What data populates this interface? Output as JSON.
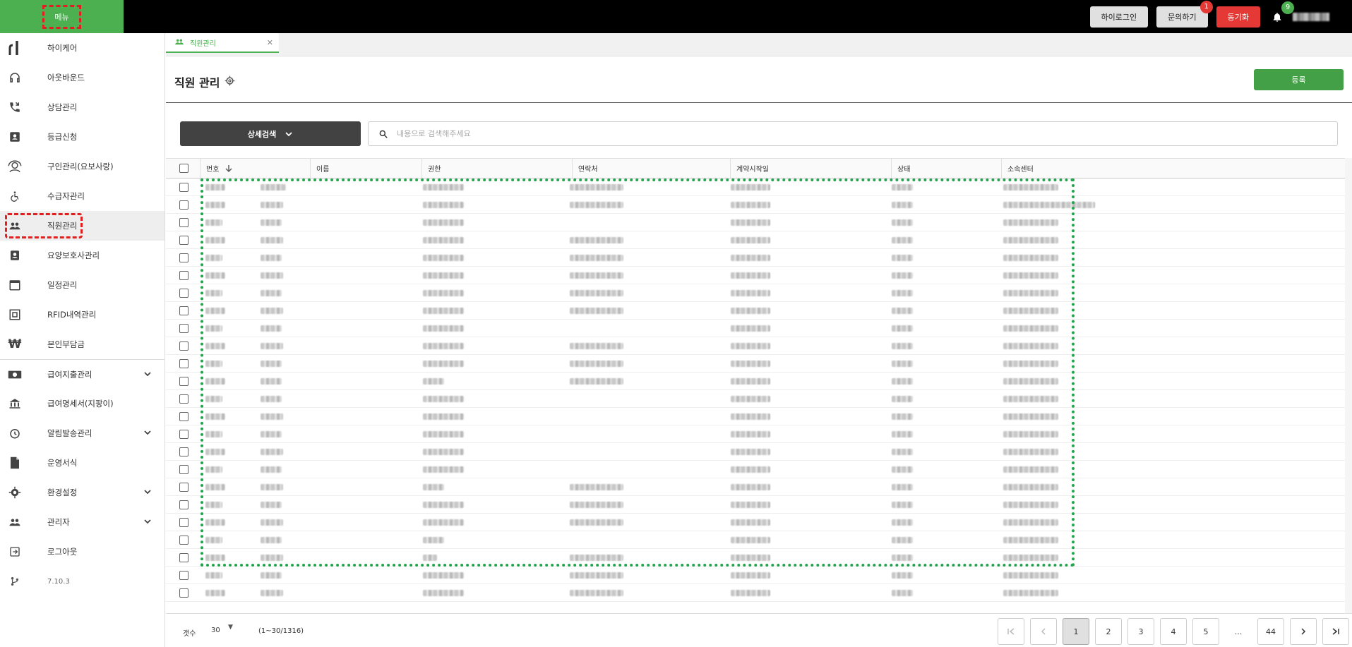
{
  "topbar": {
    "menu_label": "메뉴",
    "buttons": {
      "hi_login": "하이로그인",
      "inquiry": "문의하기",
      "inquiry_badge": "1",
      "sync": "동기화",
      "bell_badge": "9"
    }
  },
  "sidebar": {
    "items": [
      {
        "label": "하이케어",
        "icon": "hicare-logo-icon"
      },
      {
        "label": "아웃바운드",
        "icon": "headset-icon"
      },
      {
        "label": "상담관리",
        "icon": "phone-call-icon"
      },
      {
        "label": "등급신청",
        "icon": "id-card-icon"
      },
      {
        "label": "구인관리(요보사랑)",
        "icon": "support-agent-icon"
      },
      {
        "label": "수급자관리",
        "icon": "wheelchair-icon"
      },
      {
        "label": "직원관리",
        "icon": "people-icon"
      },
      {
        "label": "요양보호사관리",
        "icon": "badge-icon"
      },
      {
        "label": "일정관리",
        "icon": "calendar-icon"
      },
      {
        "label": "RFID내역관리",
        "icon": "rfid-icon"
      },
      {
        "label": "본인부담금",
        "icon": "won-icon"
      },
      {
        "label": "급여지출관리",
        "icon": "money-icon"
      },
      {
        "label": "급여명세서(지팡이)",
        "icon": "bank-icon"
      },
      {
        "label": "알림발송관리",
        "icon": "alarm-icon"
      },
      {
        "label": "운영서식",
        "icon": "document-icon"
      },
      {
        "label": "환경설정",
        "icon": "gear-icon"
      },
      {
        "label": "관리자",
        "icon": "admin-icon"
      },
      {
        "label": "로그아웃",
        "icon": "logout-icon"
      },
      {
        "label": "7.10.3",
        "icon": "branch-icon"
      }
    ]
  },
  "tab": {
    "label": "직원관리"
  },
  "header": {
    "title": "직원 관리",
    "register_label": "등록"
  },
  "search": {
    "advanced_label": "상세검색",
    "placeholder": "내용으로 검색해주세요"
  },
  "table": {
    "columns": [
      "번호",
      "이름",
      "권한",
      "연락처",
      "계약시작일",
      "상태",
      "소속센터"
    ],
    "rows": [
      [
        28,
        36,
        58,
        76,
        56,
        30,
        78
      ],
      [
        28,
        32,
        58,
        76,
        56,
        30,
        130
      ],
      [
        24,
        30,
        58,
        0,
        56,
        30,
        78
      ],
      [
        28,
        32,
        58,
        76,
        56,
        30,
        78
      ],
      [
        24,
        30,
        58,
        76,
        56,
        30,
        78
      ],
      [
        28,
        32,
        58,
        76,
        56,
        30,
        78
      ],
      [
        24,
        30,
        58,
        76,
        56,
        30,
        78
      ],
      [
        28,
        32,
        58,
        76,
        56,
        30,
        78
      ],
      [
        24,
        30,
        58,
        0,
        56,
        30,
        78
      ],
      [
        28,
        32,
        58,
        76,
        56,
        30,
        78
      ],
      [
        24,
        30,
        58,
        76,
        56,
        30,
        78
      ],
      [
        28,
        30,
        30,
        76,
        56,
        30,
        78
      ],
      [
        24,
        30,
        58,
        0,
        56,
        30,
        78
      ],
      [
        28,
        32,
        58,
        0,
        56,
        30,
        78
      ],
      [
        24,
        30,
        58,
        0,
        56,
        30,
        78
      ],
      [
        28,
        32,
        58,
        0,
        56,
        30,
        78
      ],
      [
        24,
        30,
        58,
        0,
        56,
        30,
        78
      ],
      [
        28,
        32,
        30,
        76,
        56,
        30,
        78
      ],
      [
        24,
        30,
        58,
        76,
        56,
        30,
        78
      ],
      [
        28,
        32,
        58,
        76,
        56,
        30,
        78
      ],
      [
        24,
        30,
        30,
        0,
        56,
        30,
        78
      ],
      [
        28,
        32,
        20,
        76,
        56,
        30,
        78
      ],
      [
        24,
        30,
        58,
        76,
        56,
        30,
        78
      ],
      [
        28,
        32,
        58,
        76,
        56,
        30,
        78
      ]
    ]
  },
  "footer": {
    "count_label": "갯수",
    "count_value": "30",
    "range_text": "(1~30/1316)",
    "pages": [
      "1",
      "2",
      "3",
      "4",
      "5",
      "...",
      "44"
    ]
  }
}
